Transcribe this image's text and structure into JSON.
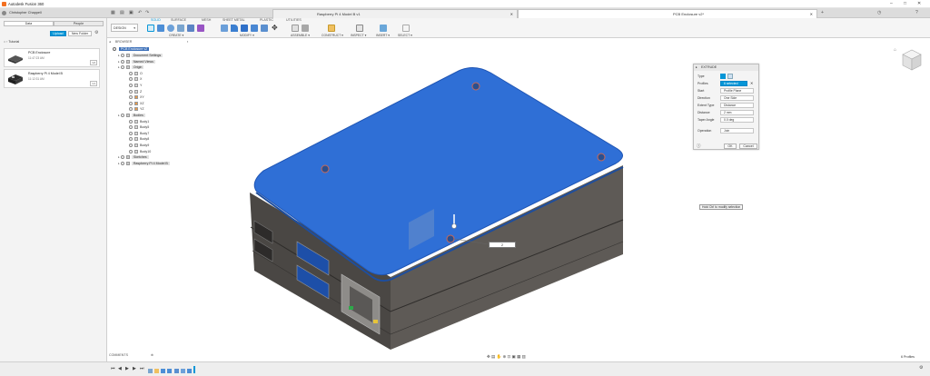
{
  "app": {
    "title": "Autodesk Fusion 360",
    "user": "Christopher Chappell",
    "tab_left_title": "Raspberry Pi 4 Model B v1",
    "tab_right_title": "PCB Enclosure v2*"
  },
  "data_panel": {
    "tabs": [
      "Data",
      "People"
    ],
    "upload_label": "Upload",
    "new_folder_label": "New Folder",
    "breadcrumb": "Tutorial",
    "files": [
      {
        "name": "PCB Enclosure",
        "date": "11:47:23 AM",
        "version": "V2"
      },
      {
        "name": "Raspberry Pi 4 Model B",
        "date": "11:12:31 AM",
        "version": "V1"
      }
    ]
  },
  "toolbar": {
    "design_label": "DESIGN",
    "workspace_tabs": [
      "SOLID",
      "SURFACE",
      "MESH",
      "SHEET METAL",
      "PLASTIC",
      "UTILITIES"
    ],
    "groups": [
      "CREATE",
      "MODIFY",
      "ASSEMBLE",
      "CONSTRUCT",
      "INSPECT",
      "INSERT",
      "SELECT"
    ]
  },
  "browser": {
    "title": "BROWSER",
    "root": "PCB Enclosure v2",
    "items": [
      {
        "label": "Document Settings",
        "level": 1
      },
      {
        "label": "Named Views",
        "level": 1
      },
      {
        "label": "Origin",
        "level": 1
      },
      {
        "label": "O",
        "level": 2
      },
      {
        "label": "X",
        "level": 2
      },
      {
        "label": "Y",
        "level": 2
      },
      {
        "label": "Z",
        "level": 2
      },
      {
        "label": "XY",
        "level": 2
      },
      {
        "label": "XZ",
        "level": 2
      },
      {
        "label": "YZ",
        "level": 2
      },
      {
        "label": "Bodies",
        "level": 1
      },
      {
        "label": "Body1",
        "level": 2
      },
      {
        "label": "Body5",
        "level": 2
      },
      {
        "label": "Body7",
        "level": 2
      },
      {
        "label": "Body8",
        "level": 2
      },
      {
        "label": "Body9",
        "level": 2
      },
      {
        "label": "Body10",
        "level": 2
      },
      {
        "label": "Sketches",
        "level": 1
      },
      {
        "label": "Raspberry Pi 4 Model B",
        "level": 1
      }
    ]
  },
  "extrude": {
    "title": "EXTRUDE",
    "rows": [
      {
        "label": "Type",
        "value": ""
      },
      {
        "label": "Profiles",
        "value": "6 selected"
      },
      {
        "label": "Start",
        "value": "Profile Plane"
      },
      {
        "label": "Direction",
        "value": "One Side"
      },
      {
        "label": "Extent Type",
        "value": "Distance"
      },
      {
        "label": "Distance",
        "value": "2 mm"
      },
      {
        "label": "Taper Angle",
        "value": "0.0 deg"
      },
      {
        "label": "Operation",
        "value": "Join"
      }
    ],
    "ok_label": "OK",
    "cancel_label": "Cancel"
  },
  "viewport": {
    "tooltip": "Hold Ctrl to modify selection",
    "distance_input": "2",
    "status_right": "6 Profiles"
  },
  "bottom": {
    "comments_label": "COMMENTS"
  },
  "colors": {
    "accent": "#0696d7",
    "selection_blue": "#2f6fd6",
    "body_dark": "#4a4744"
  }
}
